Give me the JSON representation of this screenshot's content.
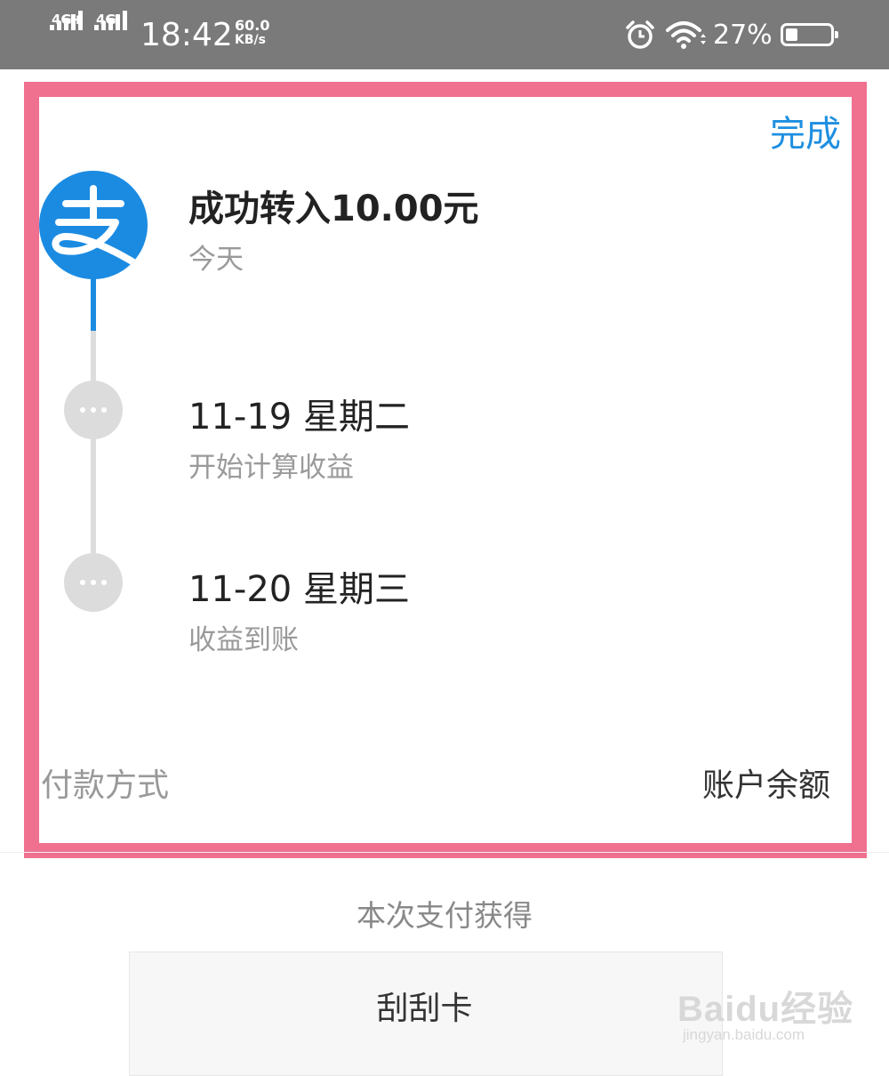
{
  "status_bar": {
    "network_1": "4G+",
    "network_2": "4G",
    "time": "18:42",
    "speed_value": "60.0",
    "speed_unit": "KB/s",
    "battery_percent": "27%",
    "battery_level": 0.27,
    "icons": [
      "signal-icon",
      "alarm-icon",
      "wifi-icon",
      "battery-icon"
    ]
  },
  "header": {
    "done_label": "完成"
  },
  "timeline": {
    "logo_glyph": "支",
    "steps": [
      {
        "title": "成功转入10.00元",
        "subtitle": "今天"
      },
      {
        "title": "11-19 星期二",
        "subtitle": "开始计算收益"
      },
      {
        "title": "11-20 星期三",
        "subtitle": "收益到账"
      }
    ]
  },
  "payment": {
    "label": "付款方式",
    "value": "账户余额"
  },
  "reward": {
    "heading": "本次支付获得",
    "card_label": "刮刮卡"
  },
  "watermark": {
    "text": "Baidu经验",
    "url": "jingyan.baidu.com"
  },
  "colors": {
    "accent": "#1e8fe0",
    "alipay_blue": "#1b8be2",
    "highlight": "#f07090",
    "status_bar": "#7a7a7a"
  }
}
